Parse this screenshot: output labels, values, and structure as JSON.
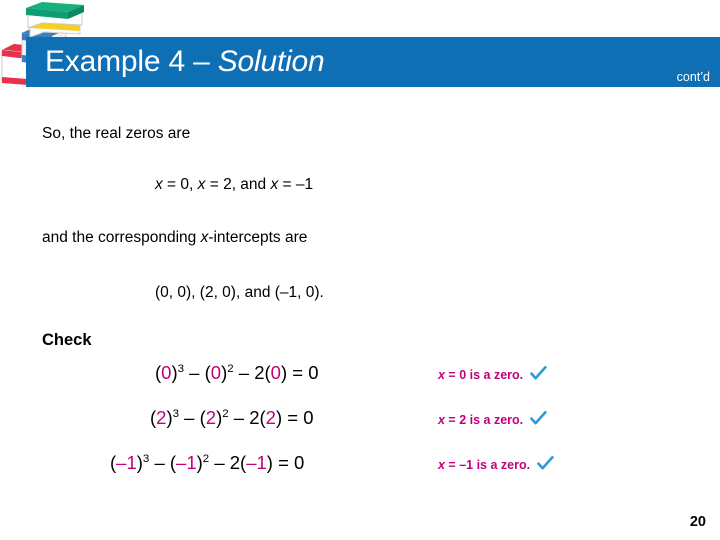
{
  "slide": {
    "title_prefix": "Example 4 – ",
    "title_italic": "Solution",
    "contd_label": "cont’d",
    "page_number": "20",
    "accent_blue": "#0f6fb5",
    "accent_magenta": "#c2007d",
    "check_blue": "#2e9bd6"
  },
  "decor": {
    "books_icon": "stack-of-books"
  },
  "body": {
    "intro_text": "So, the real zeros are",
    "zeros_line": "x = 0,   x = 2,   and   x = –1",
    "zeros_parts": {
      "x1": "x",
      "eq1": " = 0,   ",
      "x2": "x",
      "eq2": " = 2,   and   ",
      "x3": "x",
      "eq3": " = –1"
    },
    "corresponding_text_pre": "and the corresponding ",
    "corresponding_var": "x",
    "corresponding_text_post": "-intercepts are",
    "intercepts_line": "(0, 0), (2, 0),  and (–1, 0).",
    "check_heading": "Check"
  },
  "checks": [
    {
      "value": "0",
      "eq_open1": "(",
      "eq_close1": ")",
      "exp1": "3",
      "mid1": " – (",
      "eq_close2": ")",
      "exp2": "2",
      "mid2": " – 2(",
      "eq_close3": ") = 0",
      "note_var": "x",
      "note_text": " = 0 is a zero.",
      "check_icon": "check-mark-icon"
    },
    {
      "value": "2",
      "eq_open1": "(",
      "eq_close1": ")",
      "exp1": "3",
      "mid1": " – (",
      "eq_close2": ")",
      "exp2": "2",
      "mid2": " – 2(",
      "eq_close3": ") = 0",
      "note_var": "x",
      "note_text": " = 2 is a zero.",
      "check_icon": "check-mark-icon"
    },
    {
      "value": "–1",
      "eq_open1": "(",
      "eq_close1": ")",
      "exp1": "3",
      "mid1": " – (",
      "eq_close2": ")",
      "exp2": "2",
      "mid2": " – 2(",
      "eq_close3": ") = 0",
      "note_var": "x",
      "note_text": " = –1 is a zero.",
      "check_icon": "check-mark-icon"
    }
  ]
}
